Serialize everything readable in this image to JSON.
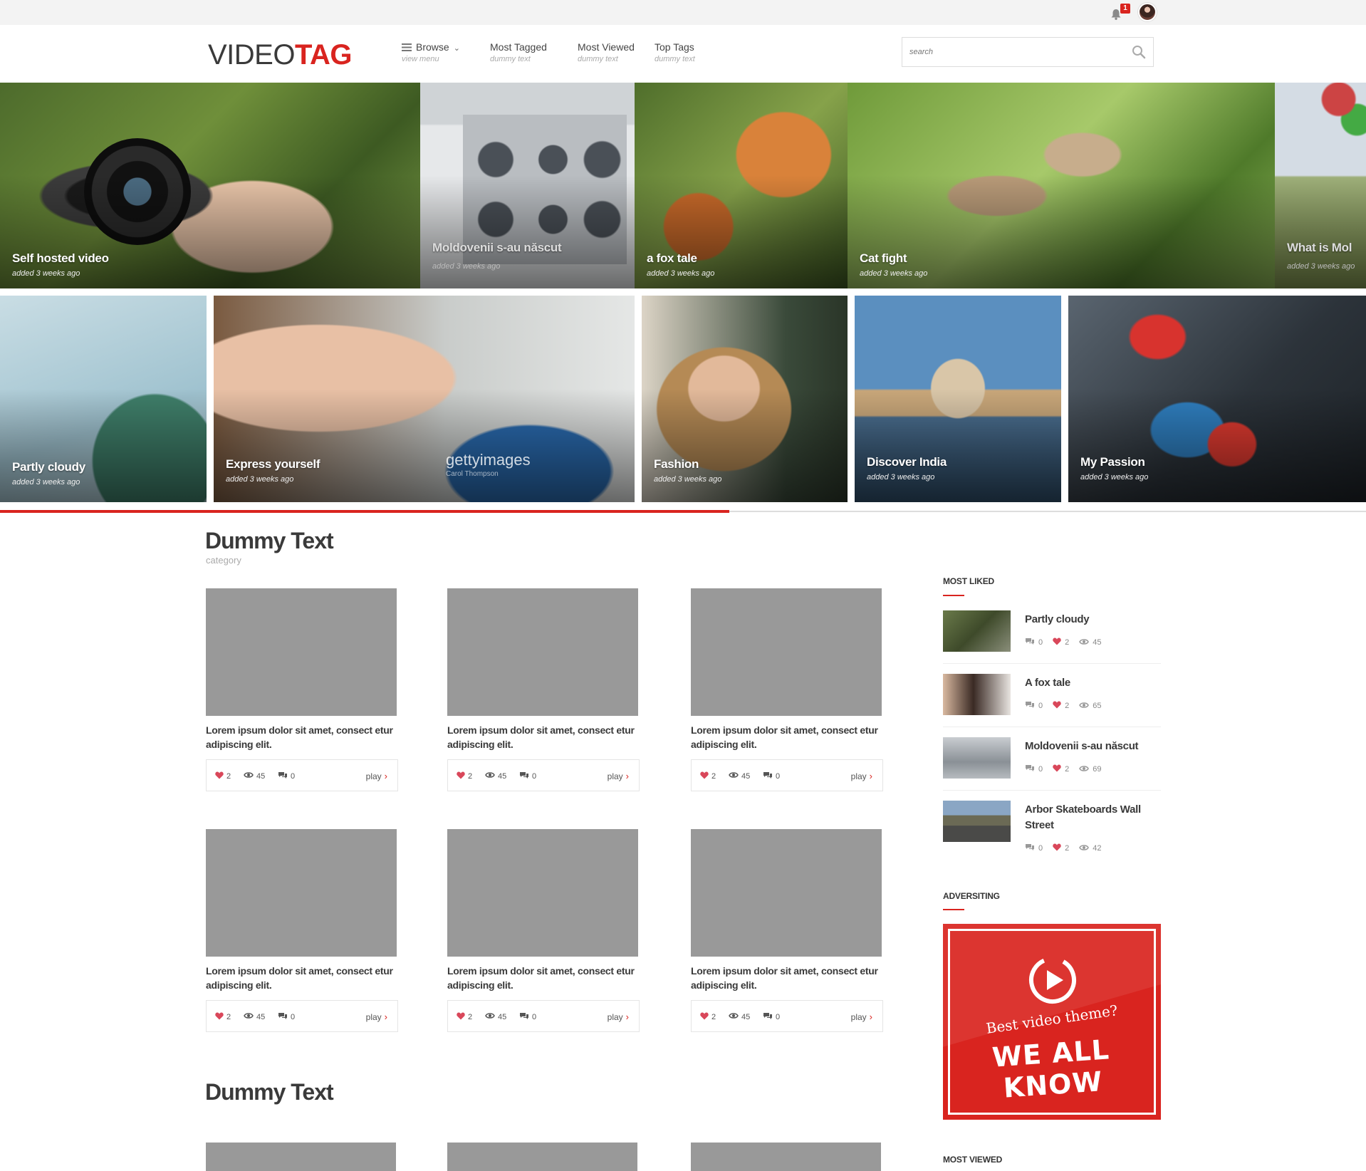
{
  "topbar": {
    "notification_count": "1"
  },
  "header": {
    "logo_part1": "VIDEO",
    "logo_part2": "TAG",
    "nav": [
      {
        "label": "Browse",
        "sub": "view menu"
      },
      {
        "label": "Most Tagged",
        "sub": "dummy text"
      },
      {
        "label": "Most Viewed",
        "sub": "dummy text"
      },
      {
        "label": "Top Tags",
        "sub": "dummy text"
      }
    ],
    "search_placeholder": "search"
  },
  "hero": [
    {
      "title": "Self  hosted video",
      "meta": "added 3 weeks ago"
    },
    {
      "title": "Moldovenii s-au născut",
      "meta": "added 3 weeks ago"
    },
    {
      "title": "a fox tale",
      "meta": "added 3 weeks ago"
    },
    {
      "title": "Cat fight",
      "meta": "added 3 weeks ago"
    },
    {
      "title": "What is Mol",
      "meta": "added 3 weeks ago"
    },
    {
      "title": "Partly cloudy",
      "meta": "added 3 weeks ago"
    },
    {
      "title": "Express yourself",
      "meta": "added 3 weeks ago",
      "watermark": "gettyimages",
      "credit": "Carol Thompson"
    },
    {
      "title": "Fashion",
      "meta": "added 3 weeks ago"
    },
    {
      "title": "Discover India",
      "meta": "added 3 weeks ago"
    },
    {
      "title": "My Passion",
      "meta": "added 3 weeks ago"
    }
  ],
  "slider_progress": 0.534,
  "sections": [
    {
      "title": "Dummy Text",
      "subtitle": "category"
    },
    {
      "title": "Dummy Text"
    }
  ],
  "cards": [
    {
      "desc": "Lorem ipsum dolor sit amet, consect etur adipiscing elit.",
      "likes": "2",
      "views": "45",
      "comments": "0",
      "play": "play"
    },
    {
      "desc": "Lorem ipsum dolor sit amet, consect etur adipiscing elit.",
      "likes": "2",
      "views": "45",
      "comments": "0",
      "play": "play"
    },
    {
      "desc": "Lorem ipsum dolor sit amet, consect etur adipiscing elit.",
      "likes": "2",
      "views": "45",
      "comments": "0",
      "play": "play"
    },
    {
      "desc": "Lorem ipsum dolor sit amet, consect etur adipiscing elit.",
      "likes": "2",
      "views": "45",
      "comments": "0",
      "play": "play"
    },
    {
      "desc": "Lorem ipsum dolor sit amet, consect etur adipiscing elit.",
      "likes": "2",
      "views": "45",
      "comments": "0",
      "play": "play"
    },
    {
      "desc": "Lorem ipsum dolor sit amet, consect etur adipiscing elit.",
      "likes": "2",
      "views": "45",
      "comments": "0",
      "play": "play"
    }
  ],
  "sidebar": {
    "most_liked_title": "MOST LIKED",
    "most_liked": [
      {
        "title": "Partly cloudy",
        "comments": "0",
        "likes": "2",
        "views": "45"
      },
      {
        "title": "A fox tale",
        "comments": "0",
        "likes": "2",
        "views": "65"
      },
      {
        "title": "Moldovenii s-au născut",
        "comments": "0",
        "likes": "2",
        "views": "69"
      },
      {
        "title": "Arbor Skateboards Wall Street",
        "comments": "0",
        "likes": "2",
        "views": "42"
      }
    ],
    "advertising_title": "ADVERSITING",
    "ad": {
      "line1": "Best video theme?",
      "line2": "WE ALL KNOW"
    },
    "most_viewed_title": "MOST VIEWED"
  },
  "colors": {
    "accent": "#d9241f",
    "placeholder": "#999999",
    "text_dark": "#3a3a3a"
  }
}
